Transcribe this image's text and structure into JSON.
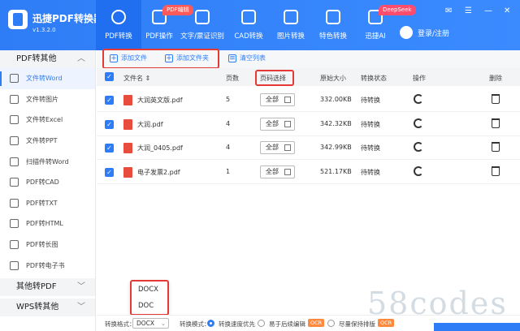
{
  "app": {
    "name": "迅捷PDF转换器",
    "version": "v1.3.2.0"
  },
  "nav": [
    {
      "label": "PDF转换",
      "badge": ""
    },
    {
      "label": "PDF操作",
      "badge": "PDF编辑"
    },
    {
      "label": "文字/票证识别",
      "badge": ""
    },
    {
      "label": "CAD转换",
      "badge": ""
    },
    {
      "label": "图片转换",
      "badge": ""
    },
    {
      "label": "特色转换",
      "badge": ""
    },
    {
      "label": "迅捷AI",
      "badge": "DeepSeek"
    }
  ],
  "login": "登录/注册",
  "sidebar": {
    "group1": "PDF转其他",
    "items": [
      "文件转Word",
      "文件转图片",
      "文件转Excel",
      "文件转PPT",
      "扫描件转Word",
      "PDF转CAD",
      "PDF转TXT",
      "PDF转HTML",
      "PDF转长图",
      "PDF转电子书"
    ],
    "group2": "其他转PDF",
    "group3": "WPS转其他"
  },
  "toolbar": {
    "add_file": "添加文件",
    "add_folder": "添加文件夹",
    "clear": "清空列表"
  },
  "table": {
    "headers": {
      "name": "文件名 ⇕",
      "pages": "页数",
      "page_select": "页码选择",
      "size": "原始大小",
      "status": "转换状态",
      "ops": "操作",
      "delete": "删除"
    },
    "rows": [
      {
        "name": "大润英文版.pdf",
        "pages": "5",
        "range": "全部",
        "size": "332.00KB",
        "status": "待转换"
      },
      {
        "name": "大润.pdf",
        "pages": "4",
        "range": "全部",
        "size": "342.32KB",
        "status": "待转换"
      },
      {
        "name": "大润_0405.pdf",
        "pages": "4",
        "range": "全部",
        "size": "342.99KB",
        "status": "待转换"
      },
      {
        "name": "电子发票2.pdf",
        "pages": "1",
        "range": "全部",
        "size": "521.17KB",
        "status": "待转换"
      }
    ]
  },
  "format_dropdown": {
    "options": [
      "DOCX",
      "DOC"
    ]
  },
  "bottom": {
    "format_label": "转换格式：",
    "format_value": "DOCX",
    "mode_label": "转换模式：",
    "mode1": "转换速度优先",
    "mode2": "易于后续编辑",
    "mode3": "尽量保持排版",
    "ocr": "OCR"
  },
  "watermark": "58codes",
  "colors": {
    "primary": "#2f7df6",
    "highlight": "#e53935",
    "ocr_badge": "#ff8a3d"
  }
}
